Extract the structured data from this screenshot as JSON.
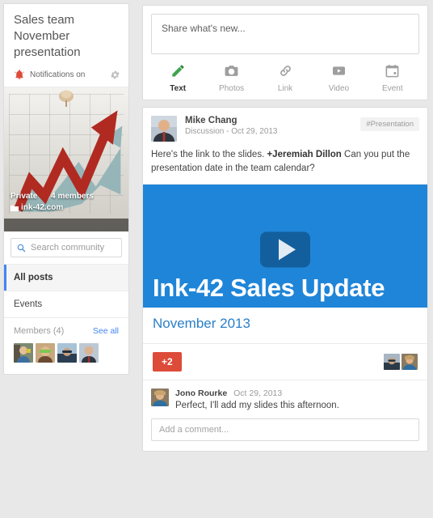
{
  "sidebar": {
    "community_title": "Sales team November presentation",
    "notifications_label": "Notifications on",
    "notifications_icon": "bell-icon",
    "settings_icon": "gear-icon",
    "cover": {
      "privacy": "Private",
      "members_count": "4 members",
      "domain": "ink-42.com",
      "domain_icon": "domain-icon",
      "pin_icon": "pushpin-icon"
    },
    "search": {
      "placeholder": "Search community",
      "value": "",
      "icon": "search-icon"
    },
    "nav": [
      {
        "label": "All posts",
        "active": true
      },
      {
        "label": "Events",
        "active": false
      }
    ],
    "members": {
      "title": "Members (4)",
      "see_all": "See all",
      "avatars": [
        "member-avatar-1",
        "member-avatar-2",
        "member-avatar-3",
        "member-avatar-4"
      ]
    }
  },
  "composer": {
    "placeholder": "Share what's new...",
    "value": "",
    "tabs": [
      {
        "label": "Text",
        "icon": "pencil-icon",
        "active": true
      },
      {
        "label": "Photos",
        "icon": "camera-icon",
        "active": false
      },
      {
        "label": "Link",
        "icon": "link-icon",
        "active": false
      },
      {
        "label": "Video",
        "icon": "video-icon",
        "active": false
      },
      {
        "label": "Event",
        "icon": "calendar-icon",
        "active": false
      }
    ]
  },
  "post": {
    "author": "Mike Chang",
    "meta": "Discussion  -  Oct 29, 2013",
    "hashtag": "#Presentation",
    "body_prefix": "Here's the link to the slides. ",
    "body_mention": "+Jeremiah Dillon",
    "body_suffix": "  Can you put the presentation date in the team calendar?",
    "attachment": {
      "slide_title": "Ink-42 Sales Update",
      "caption": "November 2013",
      "play_icon": "play-icon",
      "accent_color": "#1f85d8"
    },
    "plus_badge": "+2",
    "plus_badge_color": "#dd4b39",
    "plusers": [
      "pluser-avatar-1",
      "pluser-avatar-2"
    ]
  },
  "comment": {
    "author": "Jono Rourke",
    "date": "Oct 29, 2013",
    "text": "Perfect, I'll add my slides this afternoon.",
    "input_placeholder": "Add a comment...",
    "input_value": ""
  }
}
